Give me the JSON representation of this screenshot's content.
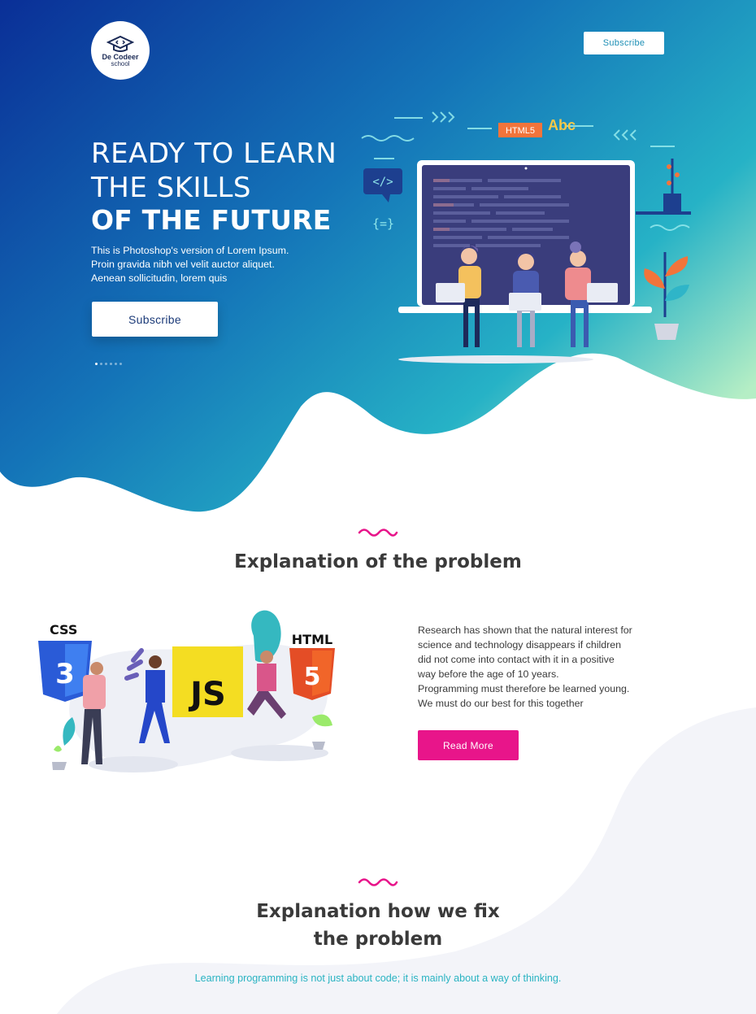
{
  "colors": {
    "hero_gradient_start": "#0b3aa0",
    "hero_gradient_end": "#3ccbc9",
    "accent_pink": "#e8158a",
    "accent_teal": "#29b3c2",
    "lower_bg": "#f3f4f9"
  },
  "header": {
    "logo_name": "De Codeer",
    "logo_sub": "school",
    "logo_icon": "graduation-cap-code-icon",
    "subscribe_label": "Subscribe"
  },
  "hero": {
    "line1": "READY TO LEARN",
    "line2": "THE SKILLS",
    "line3": "OF THE FUTURE",
    "description": [
      "This is Photoshop's version of Lorem Ipsum.",
      "Proin gravida nibh vel velit auctor aliquet.",
      "Aenean sollicitudin, lorem quis"
    ],
    "subscribe_label": "Subscribe",
    "slides_total": 6,
    "slide_active": 1,
    "illustration": {
      "html_tag": "HTML5",
      "abc_text": "Abc",
      "code_icon": "</>",
      "brace_icon": "{=}"
    }
  },
  "problem": {
    "title": "Explanation of the problem",
    "illustration": {
      "css_label": "CSS",
      "html_label": "HTML",
      "js_label": "JS",
      "css_badge": "3",
      "html_badge": "5"
    },
    "text": [
      "Research has shown that the natural interest for",
      "science and technology disappears if children",
      "did not come into contact with it in a positive",
      "way before the age of 10 years.",
      "Programming must therefore be learned young.",
      "We must do our best for this together"
    ],
    "read_more_label": "Read More"
  },
  "fix": {
    "title_line1": "Explanation how we fix",
    "title_line2": "the problem",
    "subtitle": "Learning programming is not just about code; it is mainly about a way of thinking."
  }
}
